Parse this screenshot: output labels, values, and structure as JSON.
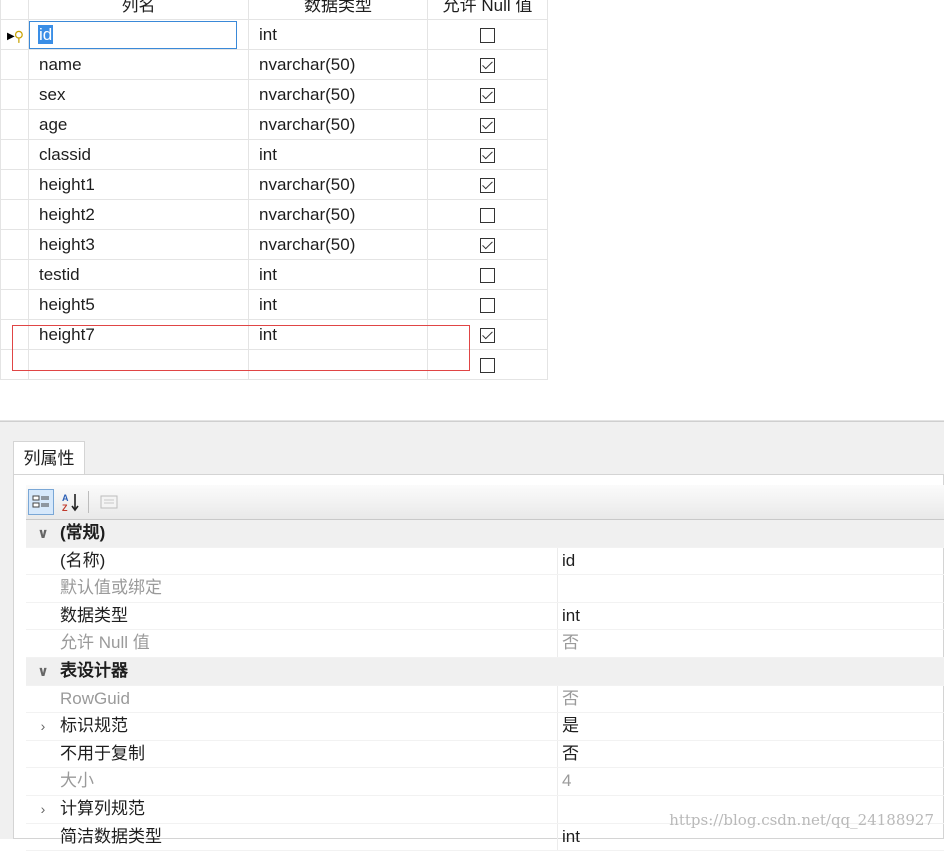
{
  "grid": {
    "headers": [
      "列名",
      "数据类型",
      "允许 Null 值"
    ],
    "rows": [
      {
        "name": "id",
        "type": "int",
        "allow_null": false
      },
      {
        "name": "name",
        "type": "nvarchar(50)",
        "allow_null": true
      },
      {
        "name": "sex",
        "type": "nvarchar(50)",
        "allow_null": true
      },
      {
        "name": "age",
        "type": "nvarchar(50)",
        "allow_null": true
      },
      {
        "name": "classid",
        "type": "int",
        "allow_null": true
      },
      {
        "name": "height1",
        "type": "nvarchar(50)",
        "allow_null": true
      },
      {
        "name": "height2",
        "type": "nvarchar(50)",
        "allow_null": false
      },
      {
        "name": "height3",
        "type": "nvarchar(50)",
        "allow_null": true
      },
      {
        "name": "testid",
        "type": "int",
        "allow_null": false
      },
      {
        "name": "height5",
        "type": "int",
        "allow_null": false
      },
      {
        "name": "height7",
        "type": "int",
        "allow_null": true
      },
      {
        "name": "",
        "type": "",
        "allow_null": false
      }
    ]
  },
  "props": {
    "tab_label": "列属性",
    "toolbar": {
      "categorized_icon": "categorized-icon",
      "alpha_icon": "alphabetical-sort-icon",
      "pages_icon": "property-pages-icon"
    },
    "rows": [
      {
        "kind": "cat",
        "label": "(常规)",
        "expander": "v"
      },
      {
        "label": "(名称)",
        "value": "id"
      },
      {
        "label": "默认值或绑定",
        "value": "",
        "dim": true
      },
      {
        "label": "数据类型",
        "value": "int"
      },
      {
        "label": "允许 Null 值",
        "value": "否",
        "dim": true
      },
      {
        "kind": "cat",
        "label": "表设计器",
        "expander": "v"
      },
      {
        "label": "RowGuid",
        "value": "否",
        "dim": true
      },
      {
        "label": "标识规范",
        "value": "是",
        "expander": ">"
      },
      {
        "label": "不用于复制",
        "value": "否"
      },
      {
        "label": "大小",
        "value": "4",
        "dim": true
      },
      {
        "label": "计算列规范",
        "value": "",
        "expander": ">"
      },
      {
        "label": "简洁数据类型",
        "value": "int"
      }
    ]
  },
  "watermark": "https://blog.csdn.net/qq_24188927"
}
